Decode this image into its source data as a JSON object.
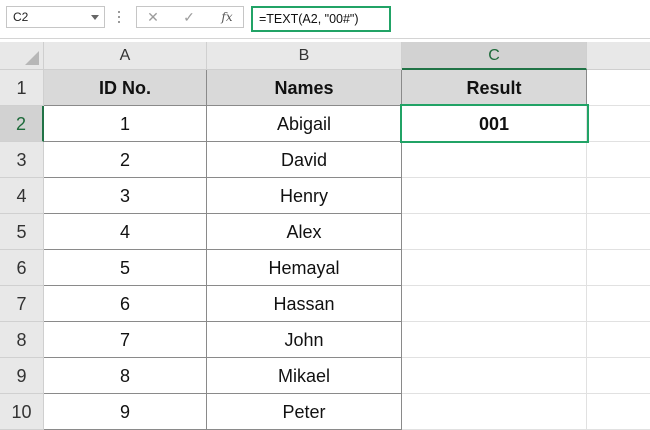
{
  "formula_bar": {
    "name_box": "C2",
    "cancel_glyph": "✕",
    "enter_glyph": "✓",
    "fx_label": "fx",
    "formula": "=TEXT(A2, \"00#\")"
  },
  "columns": [
    "A",
    "B",
    "C"
  ],
  "rows": [
    {
      "num": "1",
      "a": "ID No.",
      "b": "Names",
      "c": "Result"
    },
    {
      "num": "2",
      "a": "1",
      "b": "Abigail",
      "c": "001"
    },
    {
      "num": "3",
      "a": "2",
      "b": "David",
      "c": ""
    },
    {
      "num": "4",
      "a": "3",
      "b": "Henry",
      "c": ""
    },
    {
      "num": "5",
      "a": "4",
      "b": "Alex",
      "c": ""
    },
    {
      "num": "6",
      "a": "5",
      "b": "Hemayal",
      "c": ""
    },
    {
      "num": "7",
      "a": "6",
      "b": "Hassan",
      "c": ""
    },
    {
      "num": "8",
      "a": "7",
      "b": "John",
      "c": ""
    },
    {
      "num": "9",
      "a": "8",
      "b": "Mikael",
      "c": ""
    },
    {
      "num": "10",
      "a": "9",
      "b": "Peter",
      "c": ""
    }
  ],
  "colors": {
    "selection": "#21a366",
    "header_fill": "#d9d9d9"
  }
}
